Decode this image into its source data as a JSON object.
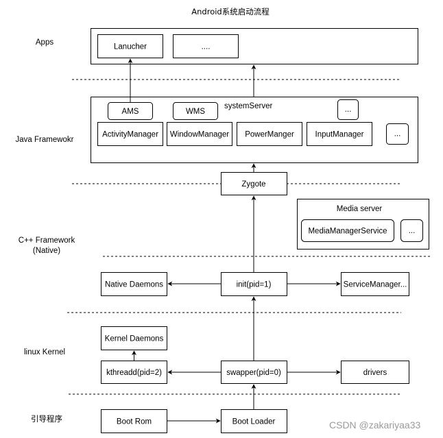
{
  "title": "Android系统启动流程",
  "layers": [
    {
      "id": "apps",
      "label": "Apps"
    },
    {
      "id": "java",
      "label": "Java Framewokr"
    },
    {
      "id": "cpp",
      "label": "C++ Framework",
      "sublabel": "(Native)"
    },
    {
      "id": "kernel",
      "label": "linux Kernel"
    },
    {
      "id": "boot",
      "label": "引导程序"
    }
  ],
  "apps": {
    "launcher": "Lanucher",
    "more": "...."
  },
  "java_framework": {
    "container": "systemServer",
    "ams": "AMS",
    "wms": "WMS",
    "more_top": "...",
    "activity_manager": "ActivityManager",
    "window_manager": "WindowManager",
    "power_manager": "PowerManger",
    "input_manager": "InputManager",
    "more_right": "..."
  },
  "zygote": "Zygote",
  "media_server": {
    "container": "Media server",
    "media_manager_service": "MediaManagerService",
    "more": "..."
  },
  "native": {
    "native_daemons": "Native Daemons",
    "init": "init(pid=1)",
    "service_manager": "ServiceManager..."
  },
  "kernel": {
    "kernel_daemons": "Kernel Daemons",
    "kthreadd": "kthreadd(pid=2)",
    "swapper": "swapper(pid=0)",
    "drivers": "drivers"
  },
  "bootloader": {
    "boot_rom": "Boot Rom",
    "boot_loader": "Boot Loader"
  },
  "edges": [
    {
      "from": "Boot Rom",
      "to": "Boot Loader"
    },
    {
      "from": "Boot Loader",
      "to": "swapper(pid=0)"
    },
    {
      "from": "swapper(pid=0)",
      "to": "kthreadd(pid=2)"
    },
    {
      "from": "swapper(pid=0)",
      "to": "drivers"
    },
    {
      "from": "kthreadd(pid=2)",
      "to": "Kernel Daemons"
    },
    {
      "from": "swapper(pid=0)",
      "to": "init(pid=1)"
    },
    {
      "from": "init(pid=1)",
      "to": "Native Daemons"
    },
    {
      "from": "init(pid=1)",
      "to": "ServiceManager..."
    },
    {
      "from": "init(pid=1)",
      "to": "Zygote"
    },
    {
      "from": "Zygote",
      "to": "systemServer"
    },
    {
      "from": "AMS",
      "to": "Lanucher"
    },
    {
      "from": "systemServer",
      "to": "Apps"
    }
  ],
  "watermark": "CSDN @zakariyaa33"
}
